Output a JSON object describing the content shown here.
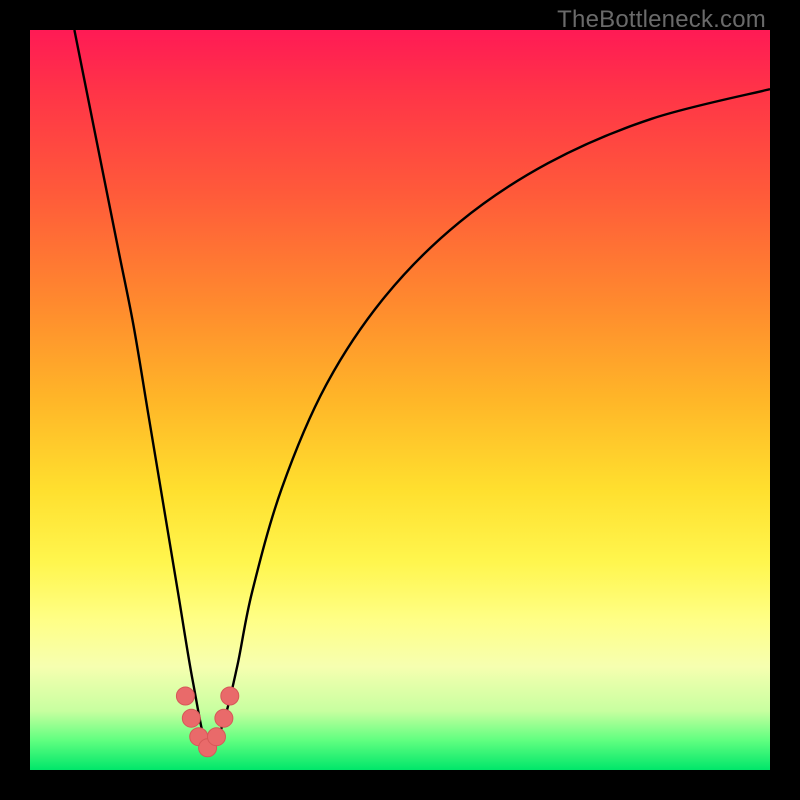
{
  "watermark": "TheBottleneck.com",
  "colors": {
    "stroke_curve": "#000000",
    "marker_fill": "#e96a6a",
    "marker_stroke": "#d65858"
  },
  "chart_data": {
    "type": "line",
    "title": "",
    "xlabel": "",
    "ylabel": "",
    "xlim": [
      0,
      100
    ],
    "ylim": [
      0,
      100
    ],
    "note": "Bottleneck V-curve. y ≈ error %, x position along horizontal axis (arbitrary 0–100). Minimum sits around x≈24, y≈2–3. Axes & ticks not rendered in image.",
    "series": [
      {
        "name": "bottleneck-curve",
        "x": [
          6,
          8,
          10,
          12,
          14,
          16,
          18,
          20,
          22,
          24,
          26,
          28,
          30,
          34,
          40,
          48,
          58,
          70,
          84,
          100
        ],
        "y": [
          100,
          90,
          80,
          70,
          60,
          48,
          36,
          24,
          12,
          3,
          6,
          14,
          24,
          38,
          52,
          64,
          74,
          82,
          88,
          92
        ]
      }
    ],
    "markers": {
      "name": "highlight-near-minimum",
      "x": [
        21.0,
        21.8,
        22.8,
        24.0,
        25.2,
        26.2,
        27.0
      ],
      "y": [
        10.0,
        7.0,
        4.5,
        3.0,
        4.5,
        7.0,
        10.0
      ]
    }
  }
}
